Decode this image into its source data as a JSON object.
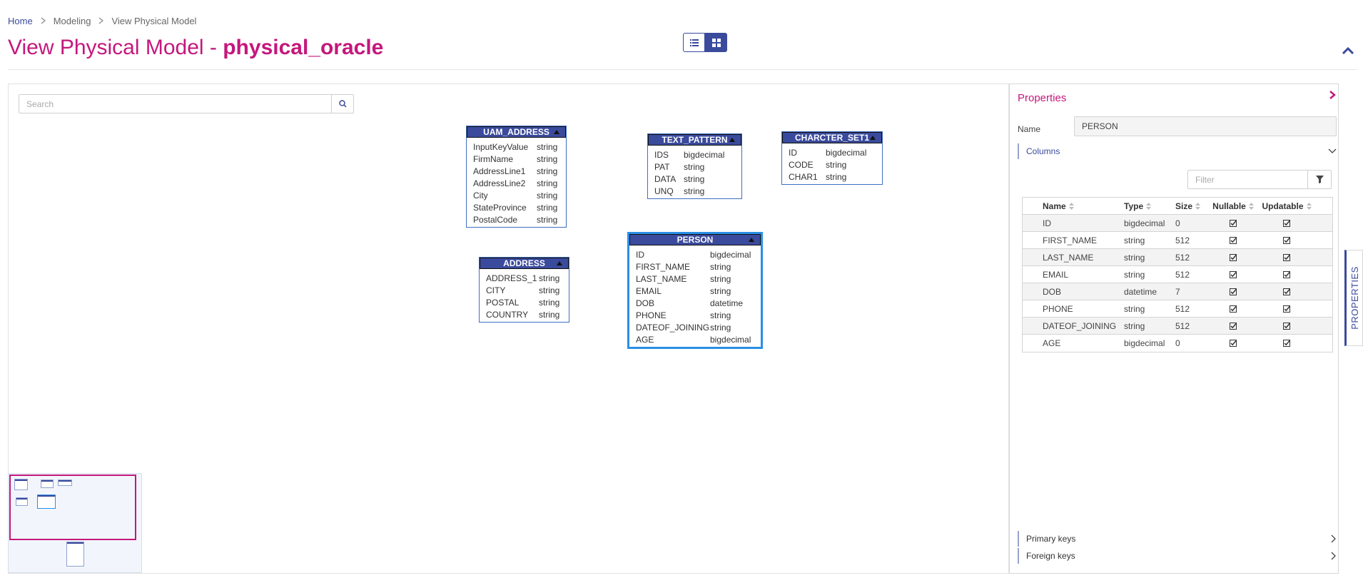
{
  "breadcrumb": {
    "items": [
      "Home",
      "Modeling",
      "View Physical Model"
    ]
  },
  "page": {
    "title_prefix": "View Physical Model - ",
    "model_name": "physical_oracle"
  },
  "search": {
    "placeholder": "Search"
  },
  "entities": {
    "uam_address": {
      "name": "UAM_ADDRESS",
      "columns": [
        {
          "name": "InputKeyValue",
          "type": "string"
        },
        {
          "name": "FirmName",
          "type": "string"
        },
        {
          "name": "AddressLine1",
          "type": "string"
        },
        {
          "name": "AddressLine2",
          "type": "string"
        },
        {
          "name": "City",
          "type": "string"
        },
        {
          "name": "StateProvince",
          "type": "string"
        },
        {
          "name": "PostalCode",
          "type": "string"
        }
      ]
    },
    "text_pattern": {
      "name": "TEXT_PATTERN",
      "columns": [
        {
          "name": "IDS",
          "type": "bigdecimal"
        },
        {
          "name": "PAT",
          "type": "string"
        },
        {
          "name": "DATA",
          "type": "string"
        },
        {
          "name": "UNQ",
          "type": "string"
        }
      ]
    },
    "charter_set1": {
      "name": "CHARCTER_SET1",
      "columns": [
        {
          "name": "ID",
          "type": "bigdecimal"
        },
        {
          "name": "CODE",
          "type": "string"
        },
        {
          "name": "CHAR1",
          "type": "string"
        }
      ]
    },
    "address": {
      "name": "ADDRESS",
      "columns": [
        {
          "name": "ADDRESS_1",
          "type": "string"
        },
        {
          "name": "CITY",
          "type": "string"
        },
        {
          "name": "POSTAL",
          "type": "string"
        },
        {
          "name": "COUNTRY",
          "type": "string"
        }
      ]
    },
    "person": {
      "name": "PERSON",
      "columns": [
        {
          "name": "ID",
          "type": "bigdecimal"
        },
        {
          "name": "FIRST_NAME",
          "type": "string"
        },
        {
          "name": "LAST_NAME",
          "type": "string"
        },
        {
          "name": "EMAIL",
          "type": "string"
        },
        {
          "name": "DOB",
          "type": "datetime"
        },
        {
          "name": "PHONE",
          "type": "string"
        },
        {
          "name": "DATEOF_JOINING",
          "type": "string"
        },
        {
          "name": "AGE",
          "type": "bigdecimal"
        }
      ]
    }
  },
  "properties": {
    "title": "Properties",
    "name_label": "Name",
    "name_value": "PERSON",
    "columns_section": "Columns",
    "filter_placeholder": "Filter",
    "table_headers": [
      "Name",
      "Type",
      "Size",
      "Nullable",
      "Updatable"
    ],
    "rows": [
      {
        "name": "ID",
        "type": "bigdecimal",
        "size": "0",
        "nullable": true,
        "updatable": true
      },
      {
        "name": "FIRST_NAME",
        "type": "string",
        "size": "512",
        "nullable": true,
        "updatable": true
      },
      {
        "name": "LAST_NAME",
        "type": "string",
        "size": "512",
        "nullable": true,
        "updatable": true
      },
      {
        "name": "EMAIL",
        "type": "string",
        "size": "512",
        "nullable": true,
        "updatable": true
      },
      {
        "name": "DOB",
        "type": "datetime",
        "size": "7",
        "nullable": true,
        "updatable": true
      },
      {
        "name": "PHONE",
        "type": "string",
        "size": "512",
        "nullable": true,
        "updatable": true
      },
      {
        "name": "DATEOF_JOINING",
        "type": "string",
        "size": "512",
        "nullable": true,
        "updatable": true
      },
      {
        "name": "AGE",
        "type": "bigdecimal",
        "size": "0",
        "nullable": true,
        "updatable": true
      }
    ],
    "primary_keys": "Primary keys",
    "foreign_keys": "Foreign keys",
    "side_tab": "PROPERTIES"
  },
  "colors": {
    "accent": "#c4177c",
    "primary": "#3a4a9c",
    "selected": "#2b8fe6"
  }
}
